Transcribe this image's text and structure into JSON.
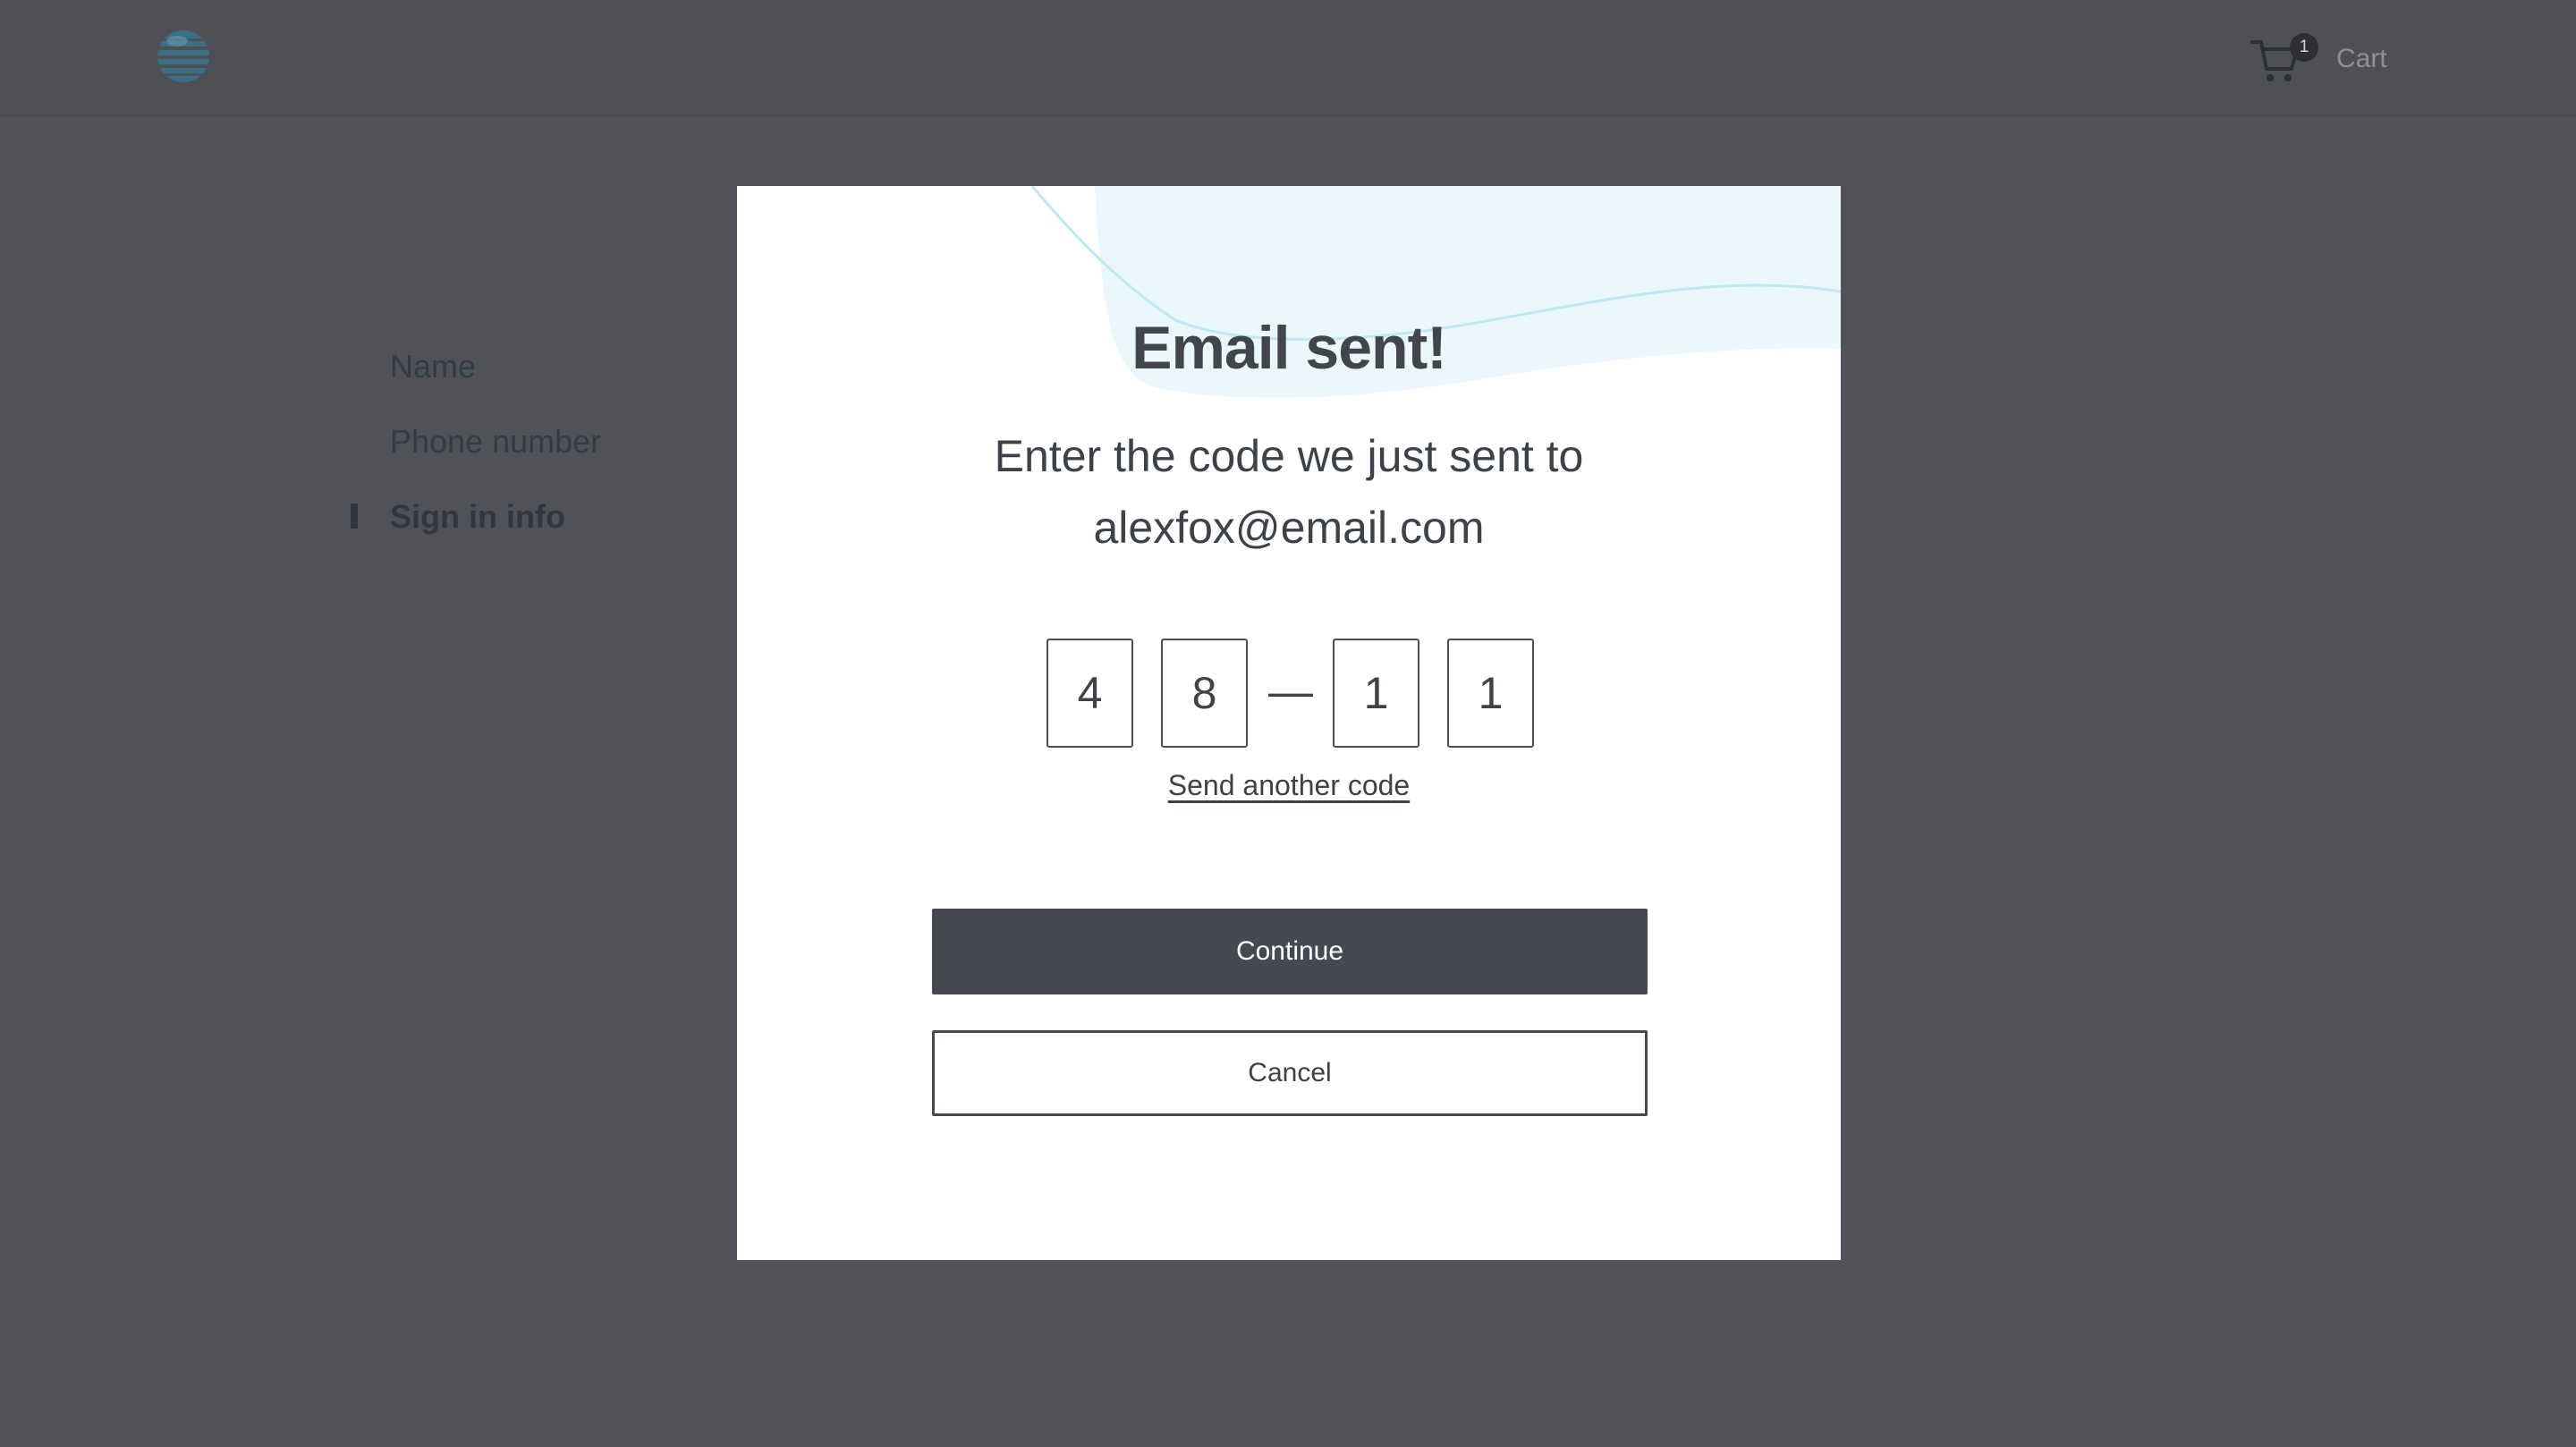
{
  "header": {
    "logo_icon": "att-globe-logo",
    "cart": {
      "icon": "shopping-cart-icon",
      "badge_count": "1",
      "label": "Cart"
    }
  },
  "steps": {
    "items": [
      {
        "label": "Name",
        "active": false
      },
      {
        "label": "Phone number",
        "active": false
      },
      {
        "label": "Sign in info",
        "active": true
      }
    ]
  },
  "modal": {
    "title": "Email sent!",
    "subtitle_line1": "Enter the code we just sent to",
    "subtitle_line2": "alexfox@email.com",
    "code": {
      "digits": [
        "4",
        "8",
        "1",
        "1"
      ],
      "separator": "—"
    },
    "resend_label": "Send another code",
    "continue_label": "Continue",
    "cancel_label": "Cancel"
  },
  "colors": {
    "overlay_background": "#505258",
    "modal_background": "#ffffff",
    "primary_button": "#454a52",
    "wave_accent": "#e6f6fc"
  }
}
